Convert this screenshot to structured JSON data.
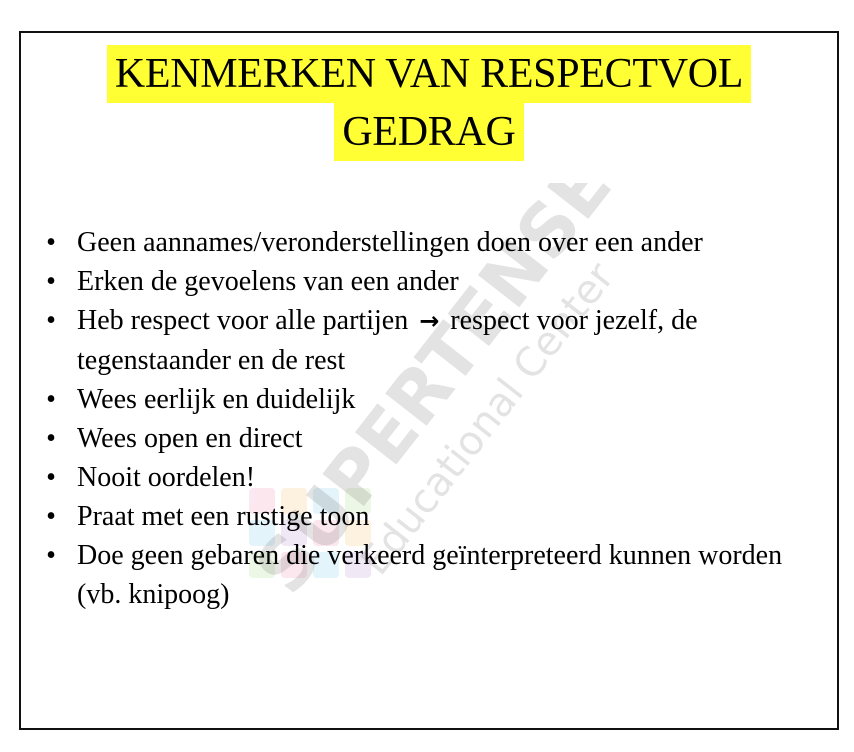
{
  "title": {
    "line1": "KENMERKEN VAN RESPECTVOL",
    "line2": "GEDRAG",
    "highlight_color": "#ffff33"
  },
  "bullets": [
    {
      "text": "Geen aannames/veronderstellingen doen over een ander"
    },
    {
      "text": "Erken de gevoelens van een ander"
    },
    {
      "before": "Heb respect voor alle partijen",
      "arrow": "→",
      "after": "respect voor jezelf, de tegenstaander en de rest"
    },
    {
      "text": "Wees eerlijk en duidelijk"
    },
    {
      "text": "Wees open en direct"
    },
    {
      "text": "Nooit oordelen!"
    },
    {
      "text": "Praat met een rustige toon"
    },
    {
      "text": "Doe geen gebaren die verkeerd geïnterpreteerd kunnen worden (vb. knipoog)"
    }
  ],
  "bullet_symbol": "•",
  "watermark": {
    "brand": "SUPERTENSE",
    "subtitle": "Educational Center",
    "icon": "colorful-grid-logo-icon"
  }
}
